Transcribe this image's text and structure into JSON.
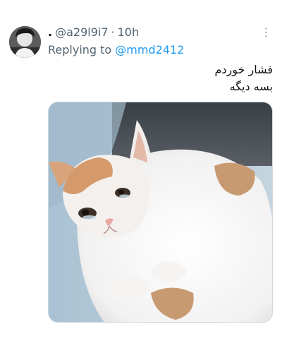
{
  "tweet": {
    "display_name": ".",
    "handle": "@a29l9i7",
    "separator": "·",
    "time": "10h",
    "reply_prefix": "Replying to",
    "reply_to": "@mmd2412",
    "text_line_1": "فشار خوردم",
    "text_line_2": "بسه دیگه",
    "media_description": "crying cat meme",
    "more_icon": "more-vertical-icon"
  },
  "colors": {
    "link": "#1d9bf0",
    "secondary_text": "#536471",
    "primary_text": "#0f1419"
  }
}
